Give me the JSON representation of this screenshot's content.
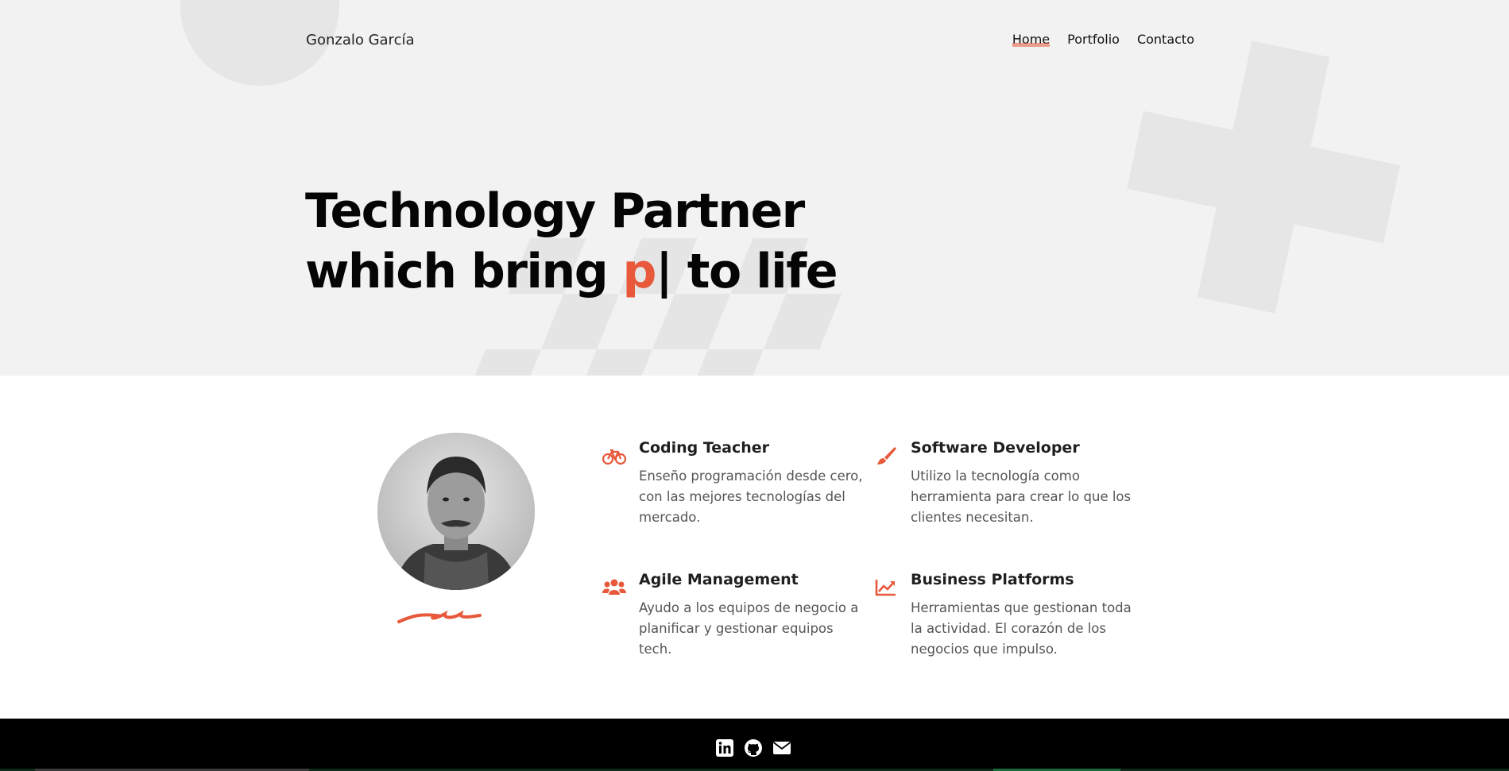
{
  "header": {
    "brand": "Gonzalo García",
    "nav": [
      {
        "label": "Home",
        "active": true
      },
      {
        "label": "Portfolio",
        "active": false
      },
      {
        "label": "Contacto",
        "active": false
      }
    ]
  },
  "hero": {
    "line1": "Technology Partner",
    "line2_prefix": "which bring ",
    "typed": "p",
    "cursor": "|",
    "line2_suffix": " to life"
  },
  "features": [
    {
      "icon": "bicycle-icon",
      "title": "Coding Teacher",
      "text": "Enseño programación desde cero, con las mejores tecnologías del mercado."
    },
    {
      "icon": "paintbrush-icon",
      "title": "Software Developer",
      "text": "Utilizo la tecnología como herramienta para crear lo que los clientes necesitan."
    },
    {
      "icon": "users-icon",
      "title": "Agile Management",
      "text": "Ayudo a los equipos de negocio a planificar y gestionar equipos tech."
    },
    {
      "icon": "chart-line-icon",
      "title": "Business Platforms",
      "text": "Herramientas que gestionan toda la actividad. El corazón de los negocios que impulso."
    }
  ],
  "footer": {
    "social": [
      "linkedin-icon",
      "github-icon",
      "envelope-icon"
    ]
  },
  "colors": {
    "accent": "#e8583b",
    "hero_bg": "#f2f2f2",
    "footer_bg": "#000000"
  }
}
